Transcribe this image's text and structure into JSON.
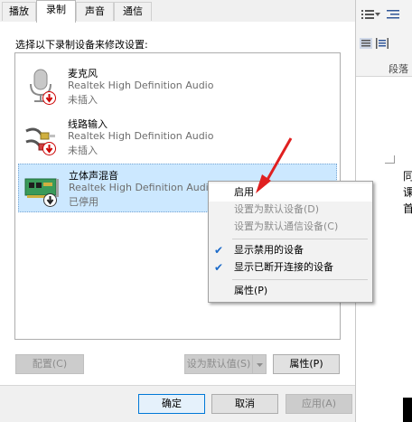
{
  "tabs": [
    {
      "label": "播放"
    },
    {
      "label": "录制"
    },
    {
      "label": "声音"
    },
    {
      "label": "通信"
    }
  ],
  "instruction": "选择以下录制设备来修改设置:",
  "devices": [
    {
      "name": "麦克风",
      "driver": "Realtek High Definition Audio",
      "state": "未插入"
    },
    {
      "name": "线路输入",
      "driver": "Realtek High Definition Audio",
      "state": "未插入"
    },
    {
      "name": "立体声混音",
      "driver": "Realtek High Definition Audio",
      "state": "已停用"
    }
  ],
  "context_menu": {
    "enable": "启用",
    "set_default": "设置为默认设备(D)",
    "set_default_comm": "设置为默认通信设备(C)",
    "show_disabled": "显示禁用的设备",
    "show_disconnected": "显示已断开连接的设备",
    "properties": "属性(P)"
  },
  "panel_buttons": {
    "configure": "配置(C)",
    "set_default": "设为默认值(S)",
    "properties": "属性(P)"
  },
  "dialog_buttons": {
    "ok": "确定",
    "cancel": "取消",
    "apply": "应用(A)"
  },
  "background_window": {
    "section_label": "段落",
    "text_line1": "同",
    "text_line2": "课",
    "text_line3": "首"
  },
  "colors": {
    "selection": "#cce8ff",
    "accent": "#0078d7",
    "arrow": "#e02020",
    "check": "#1b6ac9"
  }
}
